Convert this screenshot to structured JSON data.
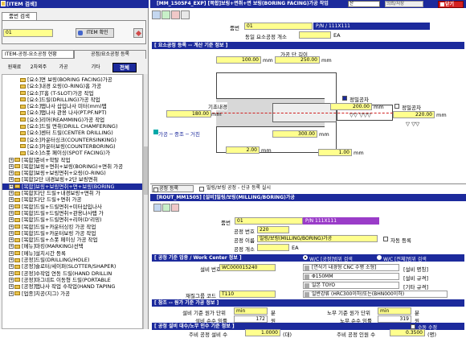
{
  "left": {
    "header": "[ITEM 검색]",
    "search_tab": "품번 검색",
    "search_value": "01",
    "item_confirm_btn": "ITEM 확인",
    "tabs": [
      "ITEM-공정-요소공정 현황",
      "공정/요소공정 등록"
    ],
    "sub_tabs": [
      "원재료",
      "2차외주",
      "가공",
      "기타",
      "전체"
    ],
    "tree": [
      "[요소]면 보링(BORING FACING)가공",
      "[요소]내경 오링(O-RING)홈 가공",
      "[요소]T홈 (T-SLOT)가공 작업",
      "[요소]드릴(DRILLING)가공 작업",
      "[요소]탭나사 삽입나사 미터(mm)탭",
      "[요소]탭나사 관용 나사(PT.PF.NPT)",
      "[요소]리머(REAMMING)가공 작업",
      "[요소]드릴 면취(DRILL CHAMFERING)",
      "[요소]센터 드릴(CENTER DRILLING)",
      "[요소]카운터싱크(COUNTERSINKING)",
      "[요소]카운터보링(COUNTERBORING)",
      "[요소]스폿 페이싱(SPOT FACING)가",
      "[복합]준비+학탈 작업",
      "[복합]보링+면취+보링(BORING)+면취 가공",
      "[복합]보링+보링면취+오링(O-RING)",
      "[복합]2단 내경보링+2단 보링면취",
      "[복합]보링+보링면취+면+보링(BORING",
      "[복합]다단 드릴+내경보링+면취 가",
      "[복합]다단 드릴+면취 가공",
      "[복합]드릴+드릴면취+미터삽입나사",
      "[복합]드릴+드릴면취+관용나사탭 가",
      "[복합]드릴+드릴면취+리머(D'리밍)",
      "[복합]드릴+카운터싱킹 가공 작업",
      "[복합]드릴+카운터보링 가공 작업",
      "[복합]드릴+스폿 페이싱 가공 작업",
      "[메뉴]마킹(MARKING)선택",
      "[메뉴]설치시간 등록",
      "[공정]드릴(DRILLING/HOLE)",
      "[공정]슬로터/세이퍼(SLOTTER/SHAPER)",
      "[공정]수작업 연동 드릴(HAND DRILLIN",
      "[공정]마그네트 이동형 드릴(PORTABLE",
      "[공정]탭나사 작업 수작업(HAND TAPING",
      "[업종]치공(지그) 가공"
    ]
  },
  "top": {
    "title": "[MM_1505F4_EXP] [복합]보링+면취+면 보링(BORING FACING)가공 작업",
    "dropdown": "산",
    "status": "의뢰/저장",
    "close_label": "닫기",
    "item_no_label": "품번",
    "item_no_value": "01",
    "item_name": "P/N / 111X111",
    "same_qty_label": "동일 요소공정 개소",
    "same_qty_unit": "EA",
    "section_title": "[ 요소공정 등록 -- 계산 기준 정보 ]",
    "length_label": "가공 단 길이",
    "v_100": "100.00",
    "u_mm1": "mm",
    "v_250": "250.00",
    "u_mm2": "mm",
    "fine_label": "정밀공차",
    "fine_label2": "정밀공차",
    "base_label": "기초내경",
    "v_180": "180.00",
    "u_mm3": "mm",
    "v_200": "200.00",
    "u_mm4": "mm",
    "v_220": "220.00",
    "u_mm5": "mm",
    "v_300": "300.00",
    "u_mm6": "mm",
    "v_2": "2.00",
    "u_mm7": "mm",
    "v_1": "1.00",
    "u_mm8": "mm",
    "arrow_text": "가공 ─ 중조 ─ 거친",
    "finish_marks": "▽▽  ▽▽▽",
    "finish_marks2": "▽ ▽▽"
  },
  "lower": {
    "reg_tab": "공정 등록",
    "reg_tab2": "밀링/보링 공정 - 신규 등록 실시",
    "title": "[ROUT_MM1505] [설비]밀링/보링(MILLING/BORING)가공",
    "item_no_label": "품번",
    "item_no_value": "01",
    "item_name": "P/N 111X111",
    "proc_no_label": "공정 번호",
    "proc_no_value": "220",
    "proc_name_label": "공정 이름",
    "proc_name_value": "밀링/보링(MILLING/BORING)가공",
    "auto_reg": "자동 등록",
    "proc_qty_label": "공정 개소",
    "proc_qty_unit": "EA",
    "wc_section": "[ 공정 기준 업종 / Work Center 정보 ]",
    "radio1": "W/C [공정]범위 검색",
    "radio2": "W/C [전체]범위 검색",
    "equip_no_label": "설비 번호",
    "equip_no_value": "WC000015240",
    "equip_desc": "[연삭기 내경형 CNC 수평 소형]",
    "equip_name_tag": "[설비 명칭]",
    "spec1": "Φ150MM",
    "spec1_tag": "[설비 규격]",
    "maker": "일본 TOYO",
    "maker_tag": "[기타 규격]",
    "material_label": "재질그룹 코드",
    "material_code": "T110",
    "material_desc": "일반강류 (HRC300이하)또는(BHN000이하)",
    "time_section": "[ 참조 -- 원가 기준 가공 정보 ]",
    "setup_label": "설비 기준 원가 단위",
    "setup_unit": "min",
    "setup_unit2": "분",
    "labor_label": "노무 기준 원가 단위",
    "labor_unit": "min",
    "labor_unit2": "분",
    "eq_rate_label": "설비 순수 임률",
    "eq_rate_value": "172",
    "eq_rate_unit": "원",
    "lab_rate_label": "노무 순수 임률",
    "lab_rate_value": "319",
    "lab_rate_unit": "원",
    "bottom_section": "[ 공정 설비 대수/노무 인수 기준 정보 ]",
    "manual_input": "수동 수정",
    "eq_count_label": "주비 공정 설비 수",
    "eq_count_value": "1.0000",
    "eq_count_unit": "(대)",
    "lab_count_label": "주비 공정 인원 수",
    "lab_count_value": "0.3500",
    "lab_count_unit": "(명)"
  },
  "colors": {
    "navy": "#1c2a9c",
    "yellow": "#ffff8e",
    "purple": "#9a3cc8",
    "cyan": "#00a8a8",
    "red": "#cc2020"
  }
}
